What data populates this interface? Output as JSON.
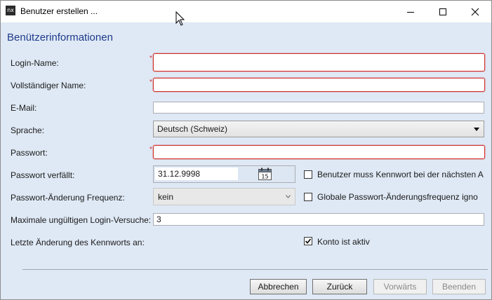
{
  "window": {
    "title": "Benutzer erstellen ...",
    "app_icon_text": "nx"
  },
  "section_title": "Benützerinformationen",
  "fields": {
    "login_name": {
      "label": "Login-Name:",
      "value": "",
      "required_mark": "*"
    },
    "full_name": {
      "label": "Vollständiger Name:",
      "value": "",
      "required_mark": "*"
    },
    "email": {
      "label": "E-Mail:",
      "value": ""
    },
    "language": {
      "label": "Sprache:",
      "value": "Deutsch (Schweiz)"
    },
    "password": {
      "label": "Passwort:",
      "value": "",
      "required_mark": "*"
    },
    "password_expires": {
      "label": "Passwort verfällt:",
      "value": "31.12.9998",
      "calendar_icon_text": "15"
    },
    "password_change_frequency": {
      "label": "Passwort-Änderung Frequenz:",
      "value": "kein"
    },
    "max_invalid_logins": {
      "label": "Maximale ungültigen Login-Versuche:",
      "value": "3"
    },
    "last_password_change": {
      "label": "Letzte Änderung des Kennworts an:"
    }
  },
  "checkboxes": {
    "must_change_password": {
      "label": "Benutzer muss Kennwort bei der nächsten An",
      "checked": false
    },
    "ignore_global_frequency": {
      "label": "Globale Passwort-Änderungsfrequenz igno",
      "checked": false
    },
    "account_active": {
      "label": "Konto ist aktiv",
      "checked": true
    }
  },
  "buttons": {
    "cancel": "Abbrechen",
    "back": "Zurück",
    "forward": "Vorwärts",
    "finish": "Beenden"
  },
  "colors": {
    "accent": "#1e3a8a",
    "error": "#d0312d",
    "background": "#dfe9f5"
  }
}
